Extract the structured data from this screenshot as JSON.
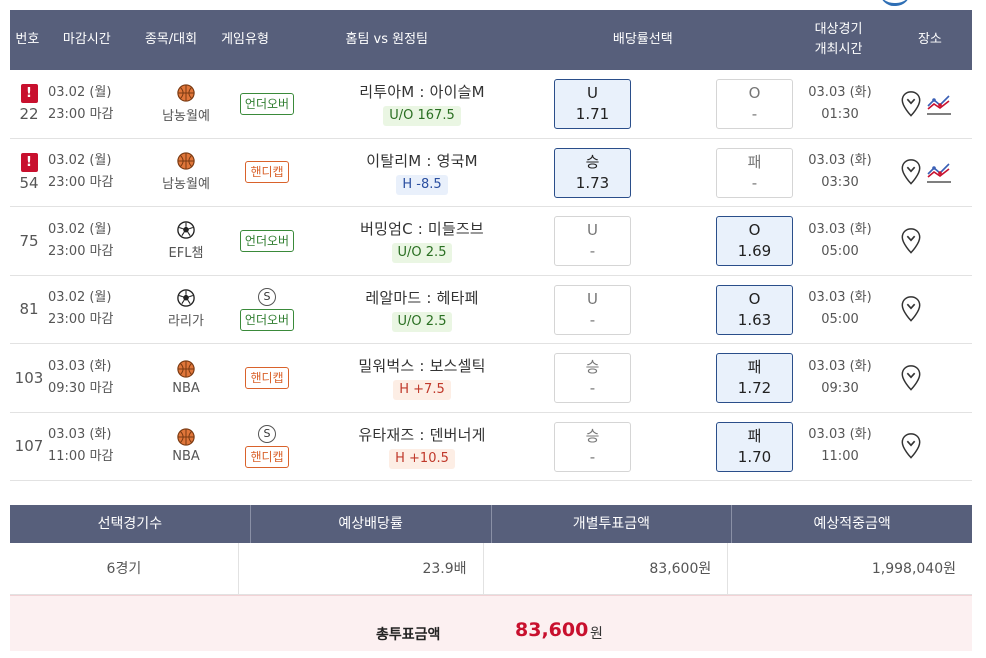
{
  "header": {
    "num": "번호",
    "deadline": "마감시간",
    "sport": "종목/대회",
    "game_type": "게임유형",
    "match": "홈팀 vs 원정팀",
    "odds": "배당률선택",
    "sched_line1": "대상경기",
    "sched_line2": "개최시간",
    "place": "장소"
  },
  "rows": [
    {
      "alert": true,
      "num": "22",
      "deadline_date": "03.02 (월)",
      "deadline_time": "23:00 마감",
      "sport_icon": "basketball-icon",
      "league": "남농월예",
      "s_badge": "",
      "type": "언더오버",
      "type_kind": "ou",
      "match": "리투아M : 아이슬M",
      "line": "U/O 167.5",
      "line_kind": "ou",
      "left_label": "U",
      "left_odds": "1.71",
      "left_selected": true,
      "right_label": "O",
      "right_odds": "-",
      "right_selected": false,
      "sched_date": "03.03 (화)",
      "sched_time": "01:30",
      "trend": true
    },
    {
      "alert": true,
      "num": "54",
      "deadline_date": "03.02 (월)",
      "deadline_time": "23:00 마감",
      "sport_icon": "basketball-icon",
      "league": "남농월예",
      "s_badge": "",
      "type": "핸디캡",
      "type_kind": "hc",
      "match": "이탈리M : 영국M",
      "line": "H -8.5",
      "line_kind": "hm",
      "left_label": "승",
      "left_odds": "1.73",
      "left_selected": true,
      "right_label": "패",
      "right_odds": "-",
      "right_selected": false,
      "sched_date": "03.03 (화)",
      "sched_time": "03:30",
      "trend": true
    },
    {
      "alert": false,
      "num": "75",
      "deadline_date": "03.02 (월)",
      "deadline_time": "23:00 마감",
      "sport_icon": "soccer-ball-icon",
      "league": "EFL챔",
      "s_badge": "",
      "type": "언더오버",
      "type_kind": "ou",
      "match": "버밍엄C : 미들즈브",
      "line": "U/O 2.5",
      "line_kind": "ou",
      "left_label": "U",
      "left_odds": "-",
      "left_selected": false,
      "right_label": "O",
      "right_odds": "1.69",
      "right_selected": true,
      "sched_date": "03.03 (화)",
      "sched_time": "05:00",
      "trend": false
    },
    {
      "alert": false,
      "num": "81",
      "deadline_date": "03.02 (월)",
      "deadline_time": "23:00 마감",
      "sport_icon": "soccer-ball-icon",
      "league": "라리가",
      "s_badge": "S",
      "type": "언더오버",
      "type_kind": "ou",
      "match": "레알마드 : 헤타페",
      "line": "U/O 2.5",
      "line_kind": "ou",
      "left_label": "U",
      "left_odds": "-",
      "left_selected": false,
      "right_label": "O",
      "right_odds": "1.63",
      "right_selected": true,
      "sched_date": "03.03 (화)",
      "sched_time": "05:00",
      "trend": false
    },
    {
      "alert": false,
      "num": "103",
      "deadline_date": "03.03 (화)",
      "deadline_time": "09:30 마감",
      "sport_icon": "basketball-icon",
      "league": "NBA",
      "s_badge": "",
      "type": "핸디캡",
      "type_kind": "hc",
      "match": "밀워벅스 : 보스셀틱",
      "line": "H +7.5",
      "line_kind": "hp",
      "left_label": "승",
      "left_odds": "-",
      "left_selected": false,
      "right_label": "패",
      "right_odds": "1.72",
      "right_selected": true,
      "sched_date": "03.03 (화)",
      "sched_time": "09:30",
      "trend": false
    },
    {
      "alert": false,
      "num": "107",
      "deadline_date": "03.03 (화)",
      "deadline_time": "11:00 마감",
      "sport_icon": "basketball-icon",
      "league": "NBA",
      "s_badge": "S",
      "type": "핸디캡",
      "type_kind": "hc",
      "match": "유타재즈 : 덴버너게",
      "line": "H +10.5",
      "line_kind": "hp",
      "left_label": "승",
      "left_odds": "-",
      "left_selected": false,
      "right_label": "패",
      "right_odds": "1.70",
      "right_selected": true,
      "sched_date": "03.03 (화)",
      "sched_time": "11:00",
      "trend": false
    }
  ],
  "summary": {
    "headers": [
      "선택경기수",
      "예상배당률",
      "개별투표금액",
      "예상적중금액"
    ],
    "values": [
      "6경기",
      "23.9배",
      "83,600원",
      "1,998,040원"
    ],
    "total_label": "총투표금액",
    "total_amount": "83,600",
    "total_unit": "원"
  },
  "colors": {
    "header_bg": "#575f7b",
    "selected_border": "#2a4e8a",
    "selected_bg": "#e9f1fb",
    "alert_red": "#c8102e",
    "total_bg": "#fcf0f1"
  }
}
